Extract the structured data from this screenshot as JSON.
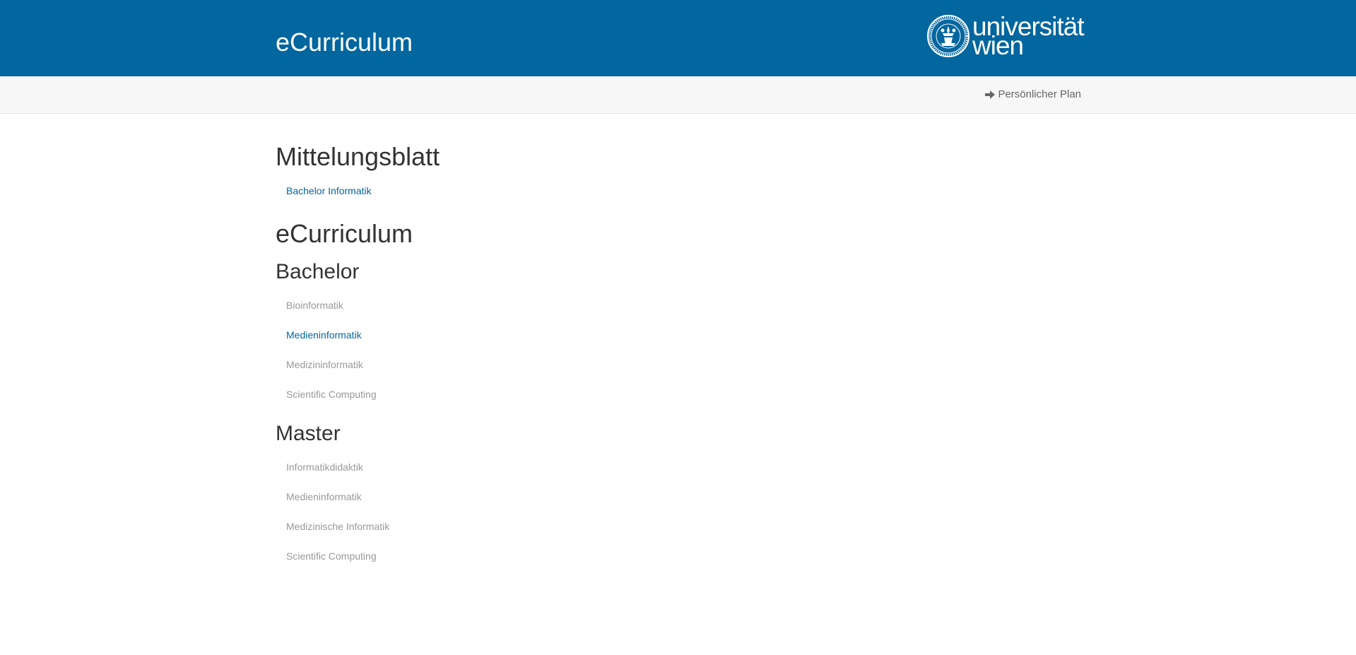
{
  "header": {
    "title": "eCurriculum",
    "logo": {
      "line1": "universität",
      "line2": "wien"
    }
  },
  "subnav": {
    "plan_icon": "arrow-right-icon",
    "plan_label": "Persönlicher Plan"
  },
  "main": {
    "mitteilungsblatt": {
      "heading": "Mittelungsblatt",
      "items": [
        {
          "label": "Bachelor Informatik",
          "active": true
        }
      ]
    },
    "ecurriculum": {
      "heading": "eCurriculum",
      "bachelor": {
        "heading": "Bachelor",
        "items": [
          {
            "label": "Bioinformatik",
            "active": false
          },
          {
            "label": "Medieninformatik",
            "active": true
          },
          {
            "label": "Medizininformatik",
            "active": false
          },
          {
            "label": "Scientific Computing",
            "active": false
          }
        ]
      },
      "master": {
        "heading": "Master",
        "items": [
          {
            "label": "Informatikdidaktik",
            "active": false
          },
          {
            "label": "Medieninformatik",
            "active": false
          },
          {
            "label": "Medizinische Informatik",
            "active": false
          },
          {
            "label": "Scientific Computing",
            "active": false
          }
        ]
      }
    }
  },
  "colors": {
    "brand": "#02669f",
    "link_active": "#02669f",
    "link_inactive": "#999999",
    "subbar": "#f7f7f7"
  }
}
